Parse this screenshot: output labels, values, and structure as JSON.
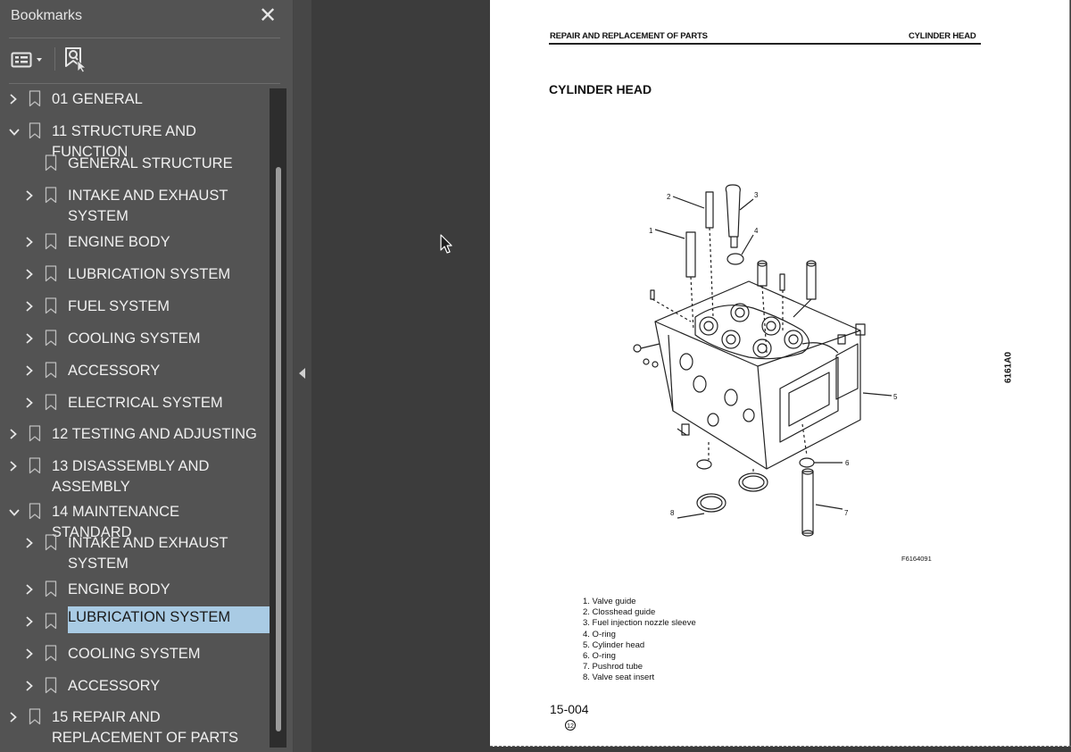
{
  "bookmarks_panel": {
    "title": "Bookmarks",
    "close_glyph": "✕",
    "items": [
      {
        "label": "01 GENERAL",
        "level": 0,
        "expander": "collapsed"
      },
      {
        "label": "11 STRUCTURE AND FUNCTION",
        "level": 0,
        "expander": "expanded"
      },
      {
        "label": "GENERAL STRUCTURE",
        "level": 1,
        "expander": "none"
      },
      {
        "label": "INTAKE AND EXHAUST SYSTEM",
        "level": 1,
        "expander": "collapsed"
      },
      {
        "label": "ENGINE BODY",
        "level": 1,
        "expander": "collapsed"
      },
      {
        "label": "LUBRICATION SYSTEM",
        "level": 1,
        "expander": "collapsed"
      },
      {
        "label": "FUEL SYSTEM",
        "level": 1,
        "expander": "collapsed"
      },
      {
        "label": "COOLING SYSTEM",
        "level": 1,
        "expander": "collapsed"
      },
      {
        "label": "ACCESSORY",
        "level": 1,
        "expander": "collapsed"
      },
      {
        "label": "ELECTRICAL SYSTEM",
        "level": 1,
        "expander": "collapsed"
      },
      {
        "label": "12 TESTING AND ADJUSTING",
        "level": 0,
        "expander": "collapsed"
      },
      {
        "label": "13 DISASSEMBLY AND ASSEMBLY",
        "level": 0,
        "expander": "collapsed"
      },
      {
        "label": "14 MAINTENANCE STANDARD",
        "level": 0,
        "expander": "expanded"
      },
      {
        "label": "INTAKE AND EXHAUST SYSTEM",
        "level": 1,
        "expander": "collapsed"
      },
      {
        "label": "ENGINE BODY",
        "level": 1,
        "expander": "collapsed"
      },
      {
        "label": "LUBRICATION SYSTEM",
        "level": 1,
        "expander": "collapsed",
        "selected": true
      },
      {
        "label": "COOLING SYSTEM",
        "level": 1,
        "expander": "collapsed"
      },
      {
        "label": "ACCESSORY",
        "level": 1,
        "expander": "collapsed"
      },
      {
        "label": "15 REPAIR AND REPLACEMENT OF PARTS",
        "level": 0,
        "expander": "collapsed"
      }
    ]
  },
  "document_page": {
    "header_left": "REPAIR AND REPLACEMENT OF PARTS",
    "header_right": "CYLINDER HEAD",
    "title": "CYLINDER HEAD",
    "side_code": "6161A0",
    "figure_code": "F6164091",
    "callouts": [
      "1",
      "2",
      "3",
      "4",
      "5",
      "6",
      "7",
      "8"
    ],
    "legend": [
      "1. Valve guide",
      "2. Closshead guide",
      "3. Fuel injection nozzle sleeve",
      "4. O-ring",
      "5. Cylinder head",
      "6. O-ring",
      "7. Pushrod tube",
      "8. Valve seat insert"
    ],
    "page_number": "15-004",
    "revision_mark": "⑫"
  },
  "colors": {
    "panel_bg": "#535353",
    "viewer_bg": "#3c3c3c",
    "selection_bg": "#a9cbe4",
    "text_light": "#f0f0f0"
  },
  "icons": {
    "close": "close-icon",
    "options": "options-menu-icon",
    "find_bookmark": "find-bookmark-icon",
    "bookmark": "bookmark-icon",
    "expand": "chevron-right-icon",
    "collapse": "chevron-down-icon"
  }
}
